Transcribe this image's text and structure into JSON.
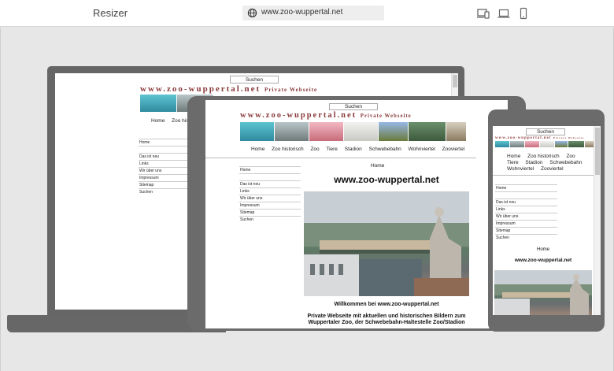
{
  "app": {
    "title": "Resizer"
  },
  "address": {
    "url": "www.zoo-wuppertal.net"
  },
  "devices": [
    "responsive-icon",
    "laptop-icon",
    "phone-icon"
  ],
  "site": {
    "search_label": "Suchen",
    "banner": "www.zoo-wuppertal.net",
    "banner_sub": "Private Webseite",
    "nav": [
      "Home",
      "Zoo historisch",
      "Zoo",
      "Tiere",
      "Stadion",
      "Schwebebahn",
      "Wohnviertel",
      "Zooviertel"
    ],
    "laptop_nav_visible": [
      "Home",
      "Zoo histori"
    ],
    "sidenav": [
      "Home",
      "",
      "Das ist neu",
      "Links",
      "Wir über uns",
      "Impressum",
      "Sitemap",
      "Suchen"
    ],
    "page_heading": "Home",
    "site_title": "www.zoo-wuppertal.net",
    "welcome": "Willkommen bei www.zoo-wuppertal.net",
    "intro": "Private Webseite mit aktuellen und historischen Bildern zum Wuppertaler Zoo, der Schwebebahn-Haltestelle Zoo/Stadion"
  }
}
